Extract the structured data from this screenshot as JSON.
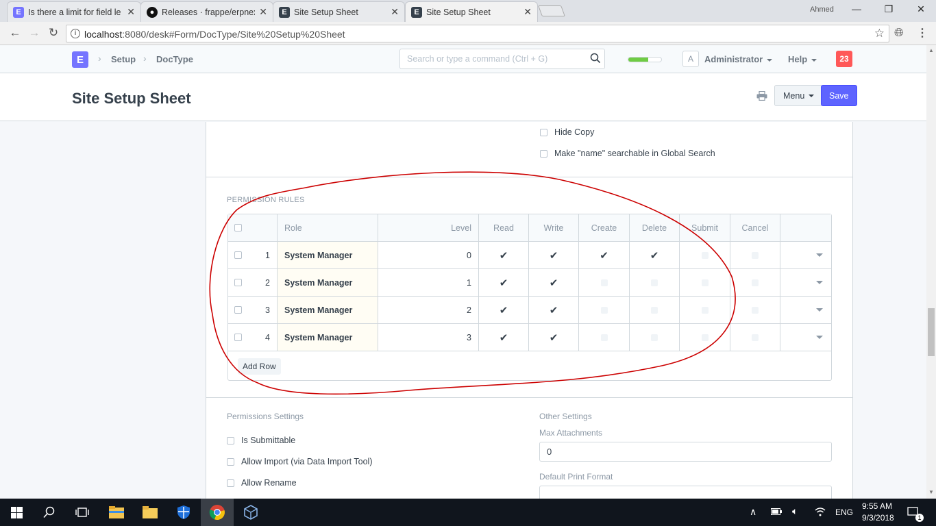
{
  "browser": {
    "tabs": [
      {
        "title": "Is there a limit for field le",
        "favicon": "erpnext-icon"
      },
      {
        "title": "Releases · frappe/erpnext",
        "favicon": "github-icon"
      },
      {
        "title": "Site Setup Sheet",
        "favicon": "erpnext-dark-icon"
      },
      {
        "title": "Site Setup Sheet",
        "favicon": "erpnext-dark-icon"
      }
    ],
    "user": "Ahmed",
    "url_host": "localhost",
    "url_rest": ":8080/desk#Form/DocType/Site%20Setup%20Sheet"
  },
  "navbar": {
    "logo": "E",
    "breadcrumbs": [
      "Setup",
      "DocType"
    ],
    "search_placeholder": "Search or type a command (Ctrl + G)",
    "progress": 0.6,
    "avatar": "A",
    "user": "Administrator",
    "help": "Help",
    "notifications": "23"
  },
  "page": {
    "title": "Site Setup Sheet",
    "menu_label": "Menu",
    "save_label": "Save"
  },
  "form": {
    "top_checks": [
      "Hide Copy",
      "Make \"name\" searchable in Global Search"
    ],
    "permission_section": "PERMISSION RULES",
    "grid": {
      "headers": [
        "Role",
        "Level",
        "Read",
        "Write",
        "Create",
        "Delete",
        "Submit",
        "Cancel"
      ],
      "rows": [
        {
          "idx": "1",
          "role": "System Manager",
          "level": "0",
          "read": true,
          "write": true,
          "create": true,
          "delete": true,
          "submit": false,
          "cancel": false
        },
        {
          "idx": "2",
          "role": "System Manager",
          "level": "1",
          "read": true,
          "write": true,
          "create": false,
          "delete": false,
          "submit": false,
          "cancel": false
        },
        {
          "idx": "3",
          "role": "System Manager",
          "level": "2",
          "read": true,
          "write": true,
          "create": false,
          "delete": false,
          "submit": false,
          "cancel": false
        },
        {
          "idx": "4",
          "role": "System Manager",
          "level": "3",
          "read": true,
          "write": true,
          "create": false,
          "delete": false,
          "submit": false,
          "cancel": false
        }
      ],
      "add_row": "Add Row"
    },
    "permissions_settings": {
      "heading": "Permissions Settings",
      "checks": [
        "Is Submittable",
        "Allow Import (via Data Import Tool)",
        "Allow Rename"
      ]
    },
    "other_settings": {
      "heading": "Other Settings",
      "max_attachments_label": "Max Attachments",
      "max_attachments_value": "0",
      "default_print_format_label": "Default Print Format",
      "default_print_format_value": ""
    }
  },
  "taskbar": {
    "apps": [
      "windows-start-icon",
      "search-icon",
      "task-view-icon",
      "file-explorer-icon",
      "folder-icon",
      "security-shield-icon",
      "chrome-icon",
      "virtualbox-icon"
    ],
    "language": "ENG",
    "time": "9:55 AM",
    "date": "9/3/2018",
    "notification_count": "1"
  },
  "colors": {
    "primary": "#5e64ff",
    "annotation": "#cc0000",
    "notification": "#ff5858",
    "progress": "#6fcc44"
  }
}
